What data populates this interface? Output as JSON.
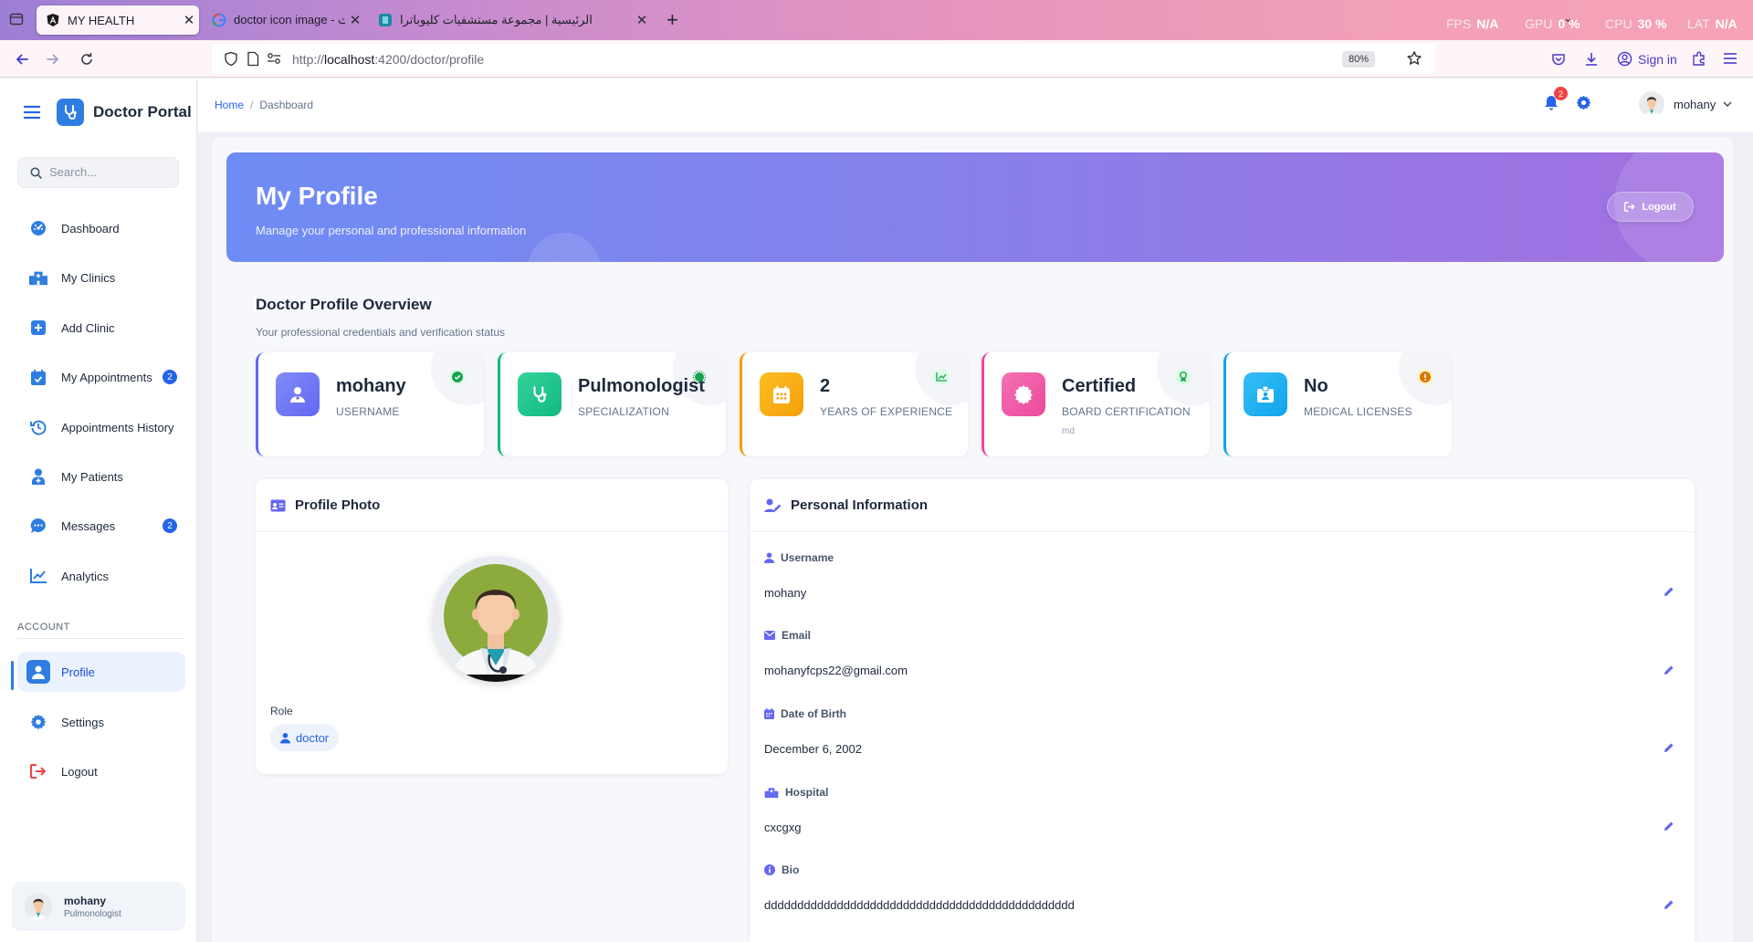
{
  "browser": {
    "tabs": [
      {
        "title": "MY HEALTH",
        "active": true
      },
      {
        "title": "doctor icon image - بحث Google",
        "active": false
      },
      {
        "title": "الرئيسية | مجموعة مستشفيات كليوباترا",
        "active": false
      }
    ],
    "new_tab": "+",
    "perf": [
      {
        "label": "FPS",
        "value": "N/A"
      },
      {
        "label": "GPU",
        "value": "0 %"
      },
      {
        "label": "CPU",
        "value": "30 %"
      },
      {
        "label": "LAT",
        "value": "N/A"
      }
    ],
    "url_prefix": "http://",
    "url_host": "localhost",
    "url_rest": ":4200/doctor/profile",
    "zoom": "80%",
    "sign_in": "Sign in"
  },
  "sidebar": {
    "brand": "Doctor Portal",
    "search_placeholder": "Search...",
    "items": [
      {
        "label": "Dashboard",
        "icon": "gauge-icon"
      },
      {
        "label": "My Clinics",
        "icon": "hospital-icon"
      },
      {
        "label": "Add Clinic",
        "icon": "plus-square-icon"
      },
      {
        "label": "My Appointments",
        "icon": "calendar-check-icon",
        "badge": "2"
      },
      {
        "label": "Appointments History",
        "icon": "history-icon"
      },
      {
        "label": "My Patients",
        "icon": "patient-icon"
      },
      {
        "label": "Messages",
        "icon": "chat-icon",
        "badge": "2"
      },
      {
        "label": "Analytics",
        "icon": "chart-icon"
      }
    ],
    "section_label": "ACCOUNT",
    "account_items": [
      {
        "label": "Profile",
        "icon": "user-icon",
        "active": true
      },
      {
        "label": "Settings",
        "icon": "gear-icon"
      },
      {
        "label": "Logout",
        "icon": "logout-icon"
      }
    ],
    "user": {
      "name": "mohany",
      "role": "Pulmonologist"
    }
  },
  "header": {
    "breadcrumb": [
      "Home",
      "Dashboard"
    ],
    "notifications": "2",
    "user_name": "mohany"
  },
  "hero": {
    "title": "My Profile",
    "subtitle": "Manage your personal and professional information",
    "logout_label": "Logout"
  },
  "overview": {
    "title": "Doctor Profile Overview",
    "subtitle": "Your professional credentials and verification status",
    "cards": [
      {
        "value": "mohany",
        "label": "USERNAME",
        "extra": "",
        "accent": "#6366f1"
      },
      {
        "value": "Pulmonologist",
        "label": "SPECIALIZATION",
        "extra": "",
        "accent": "#10b981"
      },
      {
        "value": "2",
        "label": "YEARS OF EXPERIENCE",
        "extra": "",
        "accent": "#f59e0b"
      },
      {
        "value": "Certified",
        "label": "BOARD CERTIFICATION",
        "extra": "md",
        "accent": "#ec4899"
      },
      {
        "value": "No",
        "label": "MEDICAL LICENSES",
        "extra": "",
        "accent": "#0ea5e9"
      }
    ]
  },
  "photo_card": {
    "title": "Profile Photo",
    "role_label": "Role",
    "role_value": "doctor"
  },
  "personal": {
    "title": "Personal Information",
    "fields": [
      {
        "label": "Username",
        "value": "mohany",
        "icon": "user-icon"
      },
      {
        "label": "Email",
        "value": "mohanyfcps22@gmail.com",
        "icon": "envelope-icon"
      },
      {
        "label": "Date of Birth",
        "value": "December 6, 2002",
        "icon": "calendar-icon"
      },
      {
        "label": "Hospital",
        "value": "cxcgxg",
        "icon": "hospital-icon"
      },
      {
        "label": "Bio",
        "value": "ddddddddddddddddddddddddddddddddddddddddddddddd",
        "icon": "info-icon"
      }
    ]
  }
}
